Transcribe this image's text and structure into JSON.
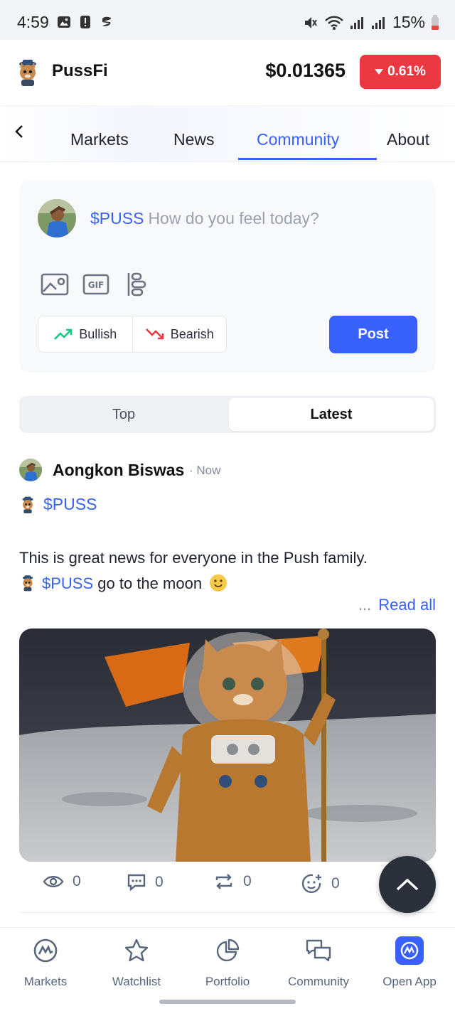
{
  "status_bar": {
    "time": "4:59",
    "battery": "15%"
  },
  "coin": {
    "name": "PussFi",
    "price": "$0.01365",
    "change": "0.61%",
    "change_color": "#ea3943"
  },
  "tabs": [
    {
      "label": "Markets",
      "active": false
    },
    {
      "label": "News",
      "active": false
    },
    {
      "label": "Community",
      "active": true
    },
    {
      "label": "About",
      "active": false
    }
  ],
  "composer": {
    "tag": "$PUSS",
    "placeholder": "How do you feel today?",
    "bullish_label": "Bullish",
    "bearish_label": "Bearish",
    "post_label": "Post",
    "tools": [
      "image-icon",
      "gif-icon",
      "poll-icon"
    ]
  },
  "feed_filter": {
    "top_label": "Top",
    "latest_label": "Latest",
    "selected": "Latest"
  },
  "post": {
    "author": "Aongkon Biswas",
    "time": "· Now",
    "tag": "$PUSS",
    "body_line1": "This is great news for everyone in the Push family.",
    "body_tag": "$PUSS",
    "body_line2": "go to the moon",
    "read_more_dots": "...",
    "read_more": "Read all",
    "stats": {
      "views": "0",
      "comments": "0",
      "reposts": "0",
      "reactions": "0"
    }
  },
  "bottom_nav": [
    {
      "label": "Markets",
      "icon": "cmc-logo-icon"
    },
    {
      "label": "Watchlist",
      "icon": "star-icon"
    },
    {
      "label": "Portfolio",
      "icon": "pie-chart-icon"
    },
    {
      "label": "Community",
      "icon": "chat-bubbles-icon"
    },
    {
      "label": "Open App",
      "icon": "cmc-app-icon"
    }
  ],
  "colors": {
    "accent": "#3861fb",
    "bullish": "#16c784",
    "bearish": "#ea3943"
  }
}
